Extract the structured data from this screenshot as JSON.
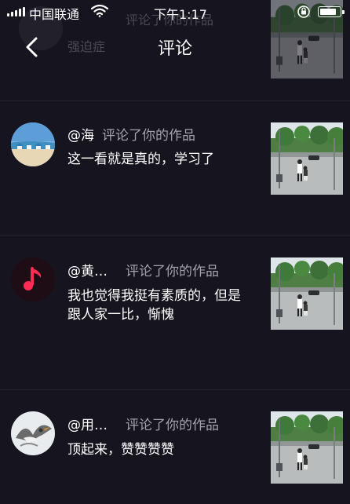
{
  "status_bar": {
    "carrier": "中国联通",
    "time": "下午1:17",
    "wifi_icon": "wifi-icon",
    "battery_icon": "battery-icon",
    "orientation_icon": "orientation-lock-icon"
  },
  "nav": {
    "title": "评论",
    "back_icon": "chevron-left-icon"
  },
  "ghost": {
    "line1": "评论了你的作品",
    "line2": "强迫症"
  },
  "comments": [
    {
      "mention": "@海",
      "action": "评论了你的作品",
      "text": "这一看就是真的，学习了",
      "avatar": "beach-avatar"
    },
    {
      "mention": "@黄…",
      "action": "评论了你的作品",
      "text": "我也觉得我挺有素质的，但是跟人家一比，惭愧",
      "avatar": "music-note-avatar"
    },
    {
      "mention": "@用…",
      "action": "评论了你的作品",
      "text": "顶起来，赞赞赞赞",
      "avatar": "bird-avatar"
    }
  ],
  "colors": {
    "background": "#16151f",
    "secondary_text": "#a3a2aa",
    "music_note": "#fe2c55"
  }
}
